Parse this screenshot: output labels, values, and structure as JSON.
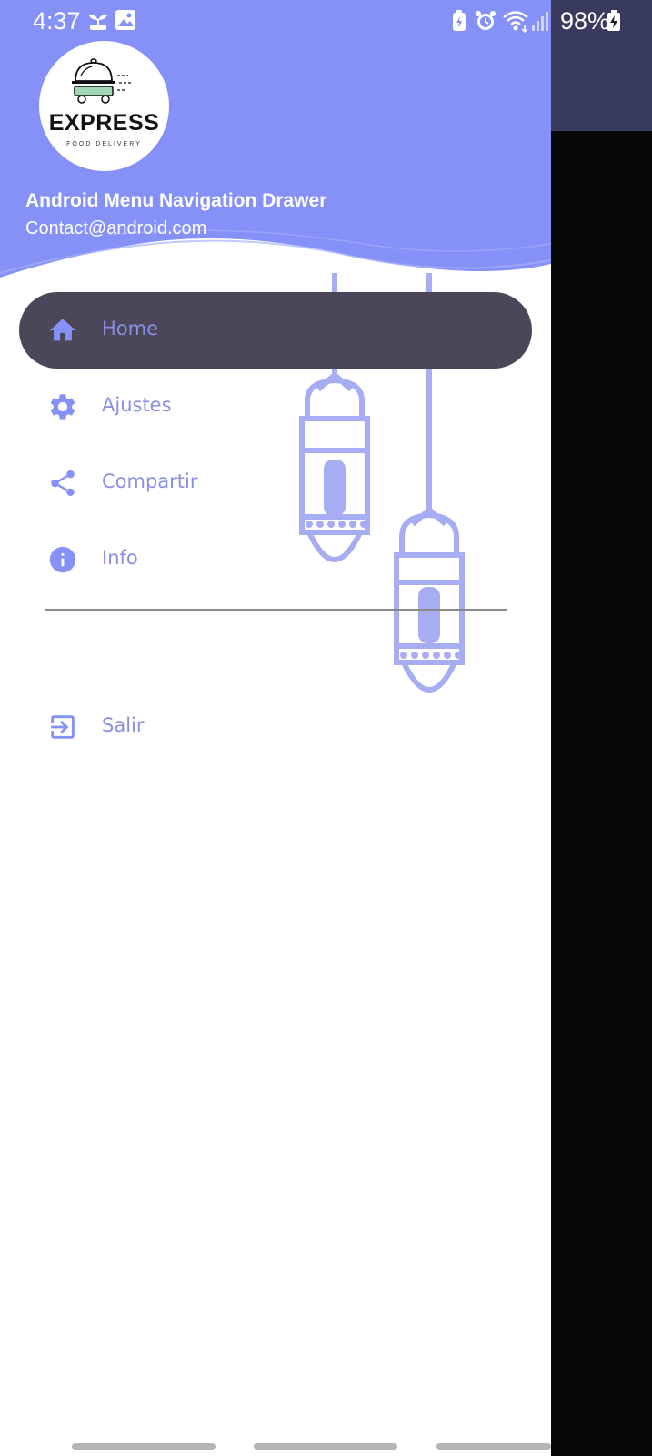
{
  "status_bar": {
    "time": "4:37",
    "battery": "98%",
    "icons": [
      "plant-icon",
      "image-icon",
      "battery-saver-icon",
      "alarm-icon",
      "wifi-icon",
      "signal-icon",
      "battery-charging-icon"
    ]
  },
  "header": {
    "logo_brand": "EXPRESS",
    "logo_sub": "FOOD DELIVERY",
    "title": "Android Menu Navigation Drawer",
    "email": "Contact@android.com"
  },
  "menu": {
    "items": [
      {
        "label": "Home",
        "icon": "home-icon",
        "active": true
      },
      {
        "label": "Ajustes",
        "icon": "gear-icon",
        "active": false
      },
      {
        "label": "Compartir",
        "icon": "share-icon",
        "active": false
      },
      {
        "label": "Info",
        "icon": "info-icon",
        "active": false
      }
    ],
    "logout": {
      "label": "Salir",
      "icon": "exit-icon"
    }
  },
  "colors": {
    "header": "#8591f7",
    "accent": "#8a8fe6",
    "active_pill": "#4b4759",
    "scrim": "#08080a"
  }
}
